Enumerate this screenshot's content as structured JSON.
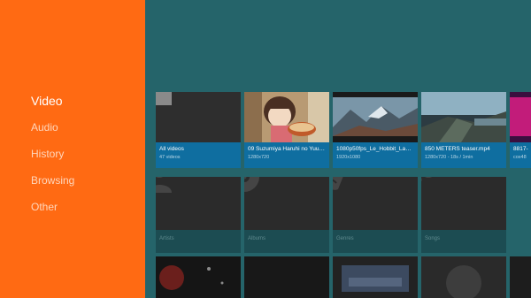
{
  "nav": {
    "items": [
      {
        "label": "Video",
        "active": true
      },
      {
        "label": "Audio",
        "active": false
      },
      {
        "label": "History",
        "active": false
      },
      {
        "label": "Browsing",
        "active": false
      },
      {
        "label": "Other",
        "active": false
      }
    ]
  },
  "videos": [
    {
      "title": "All videos",
      "subtitle": "47 videos",
      "icon": "clapperboard-icon"
    },
    {
      "title": "09 Suzumiya Haruhi no Yuuut...",
      "subtitle": "1280x720"
    },
    {
      "title": "1080p50fps_Le_Hobbit_La_d...",
      "subtitle": "1920x1080"
    },
    {
      "title": "850 METERS teaser.mp4",
      "subtitle": "1280x720 - 18s / 1min"
    },
    {
      "title": "8817-",
      "subtitle": "cox48"
    }
  ],
  "categories": [
    {
      "label": "Artists",
      "icon": "microphone-person-icon"
    },
    {
      "label": "Albums",
      "icon": "disc-icon"
    },
    {
      "label": "Genres",
      "icon": "theater-mask-icon"
    },
    {
      "label": "Songs",
      "icon": "microphone-icon"
    }
  ],
  "colors": {
    "sidebar": "#ff6a13",
    "background": "#25646a",
    "card_info": "#0f6ea0"
  }
}
